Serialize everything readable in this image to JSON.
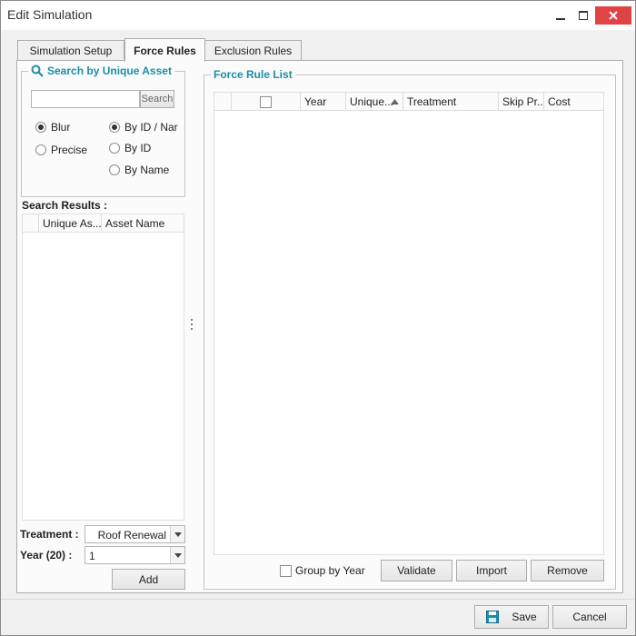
{
  "window": {
    "title": "Edit Simulation"
  },
  "tabs": [
    {
      "label": "Simulation Setup"
    },
    {
      "label": "Force Rules"
    },
    {
      "label": "Exclusion Rules"
    }
  ],
  "search_group": {
    "caption": "Search by Unique Asset",
    "search_value": "",
    "search_button": "Search",
    "match_options": [
      {
        "label": "Blur",
        "selected": true
      },
      {
        "label": "Precise",
        "selected": false
      }
    ],
    "field_options": [
      {
        "label": "By ID / Nar",
        "selected": true
      },
      {
        "label": "By ID",
        "selected": false
      },
      {
        "label": "By Name",
        "selected": false
      }
    ]
  },
  "search_results": {
    "label": "Search Results :",
    "columns": [
      "Unique As...",
      "Asset Name"
    ],
    "rows": []
  },
  "treatment": {
    "label": "Treatment :",
    "value": "Roof Renewal"
  },
  "year": {
    "label": "Year (20) :",
    "value": "1"
  },
  "add_button": "Add",
  "force_rule_list": {
    "caption": "Force Rule List",
    "columns": [
      "Year",
      "Unique...",
      "Treatment",
      "Skip Pr...",
      "Cost"
    ],
    "rows": [],
    "group_by_year": "Group by Year",
    "validate": "Validate",
    "import": "Import",
    "remove": "Remove"
  },
  "footer": {
    "save": "Save",
    "cancel": "Cancel"
  },
  "colors": {
    "accent": "#1b8ea6",
    "close": "#e04343"
  }
}
